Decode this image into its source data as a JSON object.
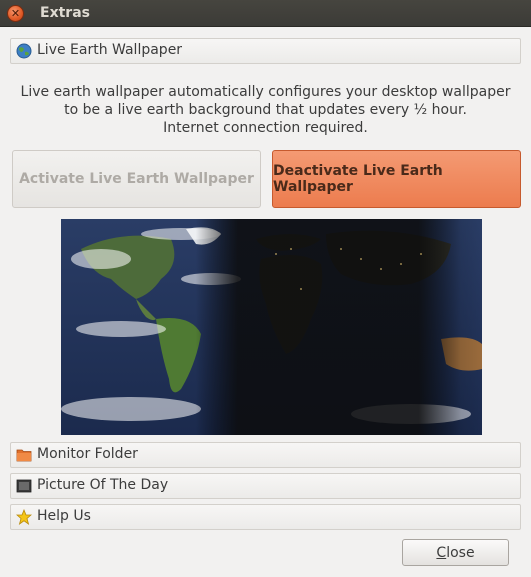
{
  "window": {
    "title": "Extras"
  },
  "sections": {
    "live_earth": {
      "label": "Live Earth Wallpaper",
      "icon": "globe-icon"
    },
    "monitor_folder": {
      "label": "Monitor Folder",
      "icon": "folder-icon"
    },
    "picture_of_the_day": {
      "label": "Picture Of The Day",
      "icon": "picture-icon"
    },
    "help_us": {
      "label": "Help Us",
      "icon": "star-icon"
    }
  },
  "live_earth": {
    "description_line1": "Live earth wallpaper automatically configures your desktop wallpaper",
    "description_line2": "to be a live earth background that updates every ½ hour.",
    "description_line3": "Internet connection required.",
    "activate_label": "Activate Live Earth Wallpaper",
    "deactivate_label": "Deactivate Live Earth Wallpaper",
    "preview_image": "live-earth-map-preview"
  },
  "footer": {
    "close_label_mnemonic": "C",
    "close_label_rest": "lose"
  },
  "colors": {
    "accent": "#ec7c4e",
    "titlebar": "#3c3b37",
    "background": "#f2f1f0"
  }
}
